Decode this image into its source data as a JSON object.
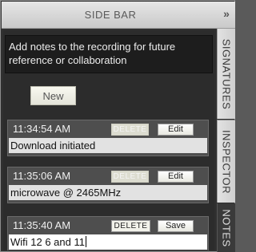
{
  "header": {
    "title": "SIDE BAR",
    "collapse_glyph": "»"
  },
  "intro_text": "Add notes to the recording for future reference or collaboration",
  "new_button": "New",
  "notes": [
    {
      "time": "11:34:54 AM",
      "delete_label": "DELETE",
      "action_label": "Edit",
      "text": "Download initiated"
    },
    {
      "time": "11:35:06 AM",
      "delete_label": "DELETE",
      "action_label": "Edit",
      "text": "microwave @ 2465MHz"
    },
    {
      "time": "11:35:40 AM",
      "delete_label": "DELETE",
      "action_label": "Save",
      "text": "Wifi 12 6 and 11"
    }
  ],
  "tabs": [
    {
      "label": "SIGNATURES",
      "active": false
    },
    {
      "label": "INSPECTOR",
      "active": false
    },
    {
      "label": "NOTES",
      "active": true
    }
  ]
}
